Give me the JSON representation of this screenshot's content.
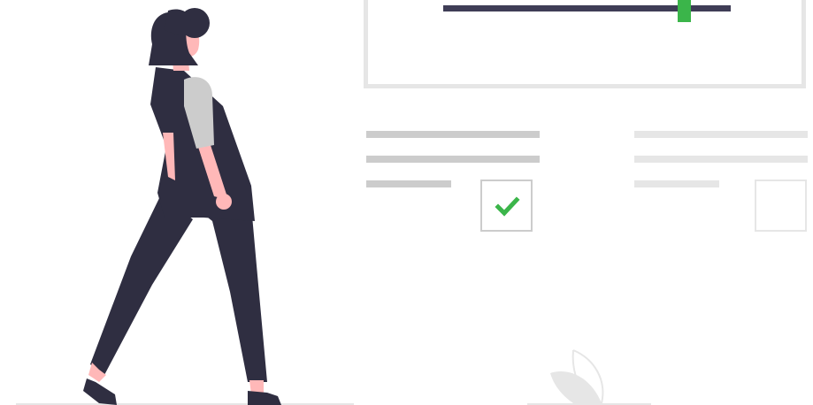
{
  "colors": {
    "dark": "#2f2e41",
    "slate": "#3f3d56",
    "accent_green": "#3bb54a",
    "skin": "#ffb8b8",
    "sleeve_gray": "#cccccc",
    "line_dark": "#cccccc",
    "line_light": "#e6e6e6",
    "plant": "#e6e6e6"
  },
  "slider": {
    "value_fraction": 0.82
  },
  "checklist": {
    "items": [
      {
        "checked": true
      },
      {
        "checked": false
      }
    ]
  },
  "icons": {
    "checkbox_mark": "check-icon",
    "illustration": "woman-walking-illustration",
    "plant": "plant-leaf-icon"
  }
}
